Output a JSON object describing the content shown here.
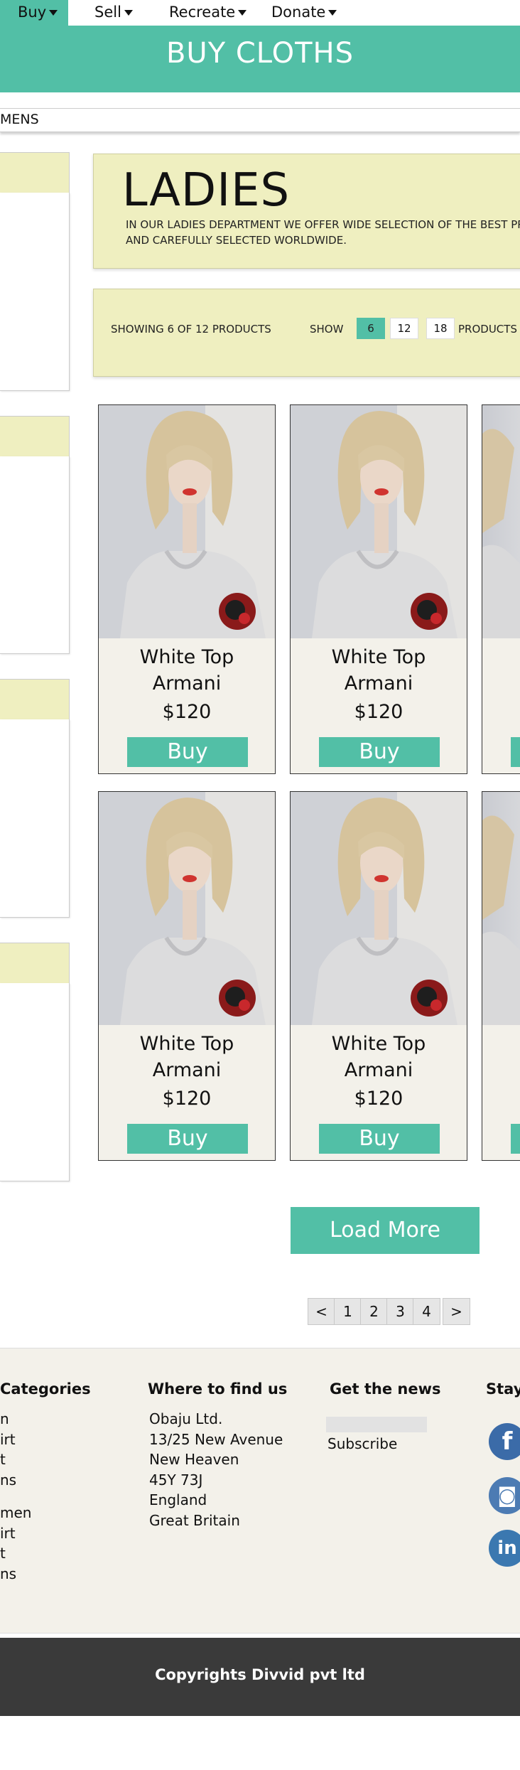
{
  "nav": {
    "items": [
      {
        "label": "Buy"
      },
      {
        "label": "Sell"
      },
      {
        "label": "Recreate"
      },
      {
        "label": "Donate"
      }
    ]
  },
  "header": {
    "title": "BUY CLOTHS"
  },
  "breadcrumb": {
    "text": "MENS"
  },
  "department": {
    "title": "LADIES",
    "description": "In our Ladies department we offer wide selection of the best prod and carefully selected worldwide."
  },
  "listing": {
    "showing": "SHOWING 6 OF 12 PRODUCTS",
    "show_label": "SHOW",
    "sizes": [
      "6",
      "12",
      "18"
    ],
    "selected_size": "6",
    "products_label": "PRODUCTS"
  },
  "products": [
    {
      "name_line1": "White Top",
      "name_line2": "Armani",
      "price": "$120",
      "buy_label": "Buy"
    },
    {
      "name_line1": "White Top",
      "name_line2": "Armani",
      "price": "$120",
      "buy_label": "Buy"
    },
    {
      "name_line1": "White Top",
      "name_line2": "Armani",
      "price": "$120",
      "buy_label": "Buy"
    },
    {
      "name_line1": "White Top",
      "name_line2": "Armani",
      "price": "$120",
      "buy_label": "Buy"
    }
  ],
  "load_more": {
    "label": "Load More"
  },
  "pagination": {
    "prev": "<",
    "pages": [
      "1",
      "2",
      "3",
      "4"
    ],
    "next": ">"
  },
  "footer": {
    "categories": {
      "heading": "Categories",
      "items": [
        "n",
        "irt",
        "t",
        "ns",
        "men",
        "irt",
        "t",
        "ns"
      ]
    },
    "location": {
      "heading": "Where to find us",
      "lines": [
        "Obaju Ltd.",
        "13/25 New Avenue",
        "New Heaven",
        "45Y 73J",
        "England",
        "Great Britain"
      ]
    },
    "news": {
      "heading": "Get the news",
      "input_value": "",
      "subscribe_label": "Subscribe"
    },
    "stay": {
      "heading": "Stay",
      "social": [
        {
          "icon": "facebook-icon",
          "glyph": "f"
        },
        {
          "icon": "instagram-icon",
          "glyph": "◙"
        },
        {
          "icon": "linkedin-icon",
          "glyph": "in"
        }
      ]
    }
  },
  "copyright": {
    "text": "Copyrights Divvid pvt ltd"
  },
  "colors": {
    "accent": "#52bfa6",
    "panel": "#efefc0",
    "footer": "#f3f1ea",
    "copyright_bg": "#3a3a3a"
  }
}
